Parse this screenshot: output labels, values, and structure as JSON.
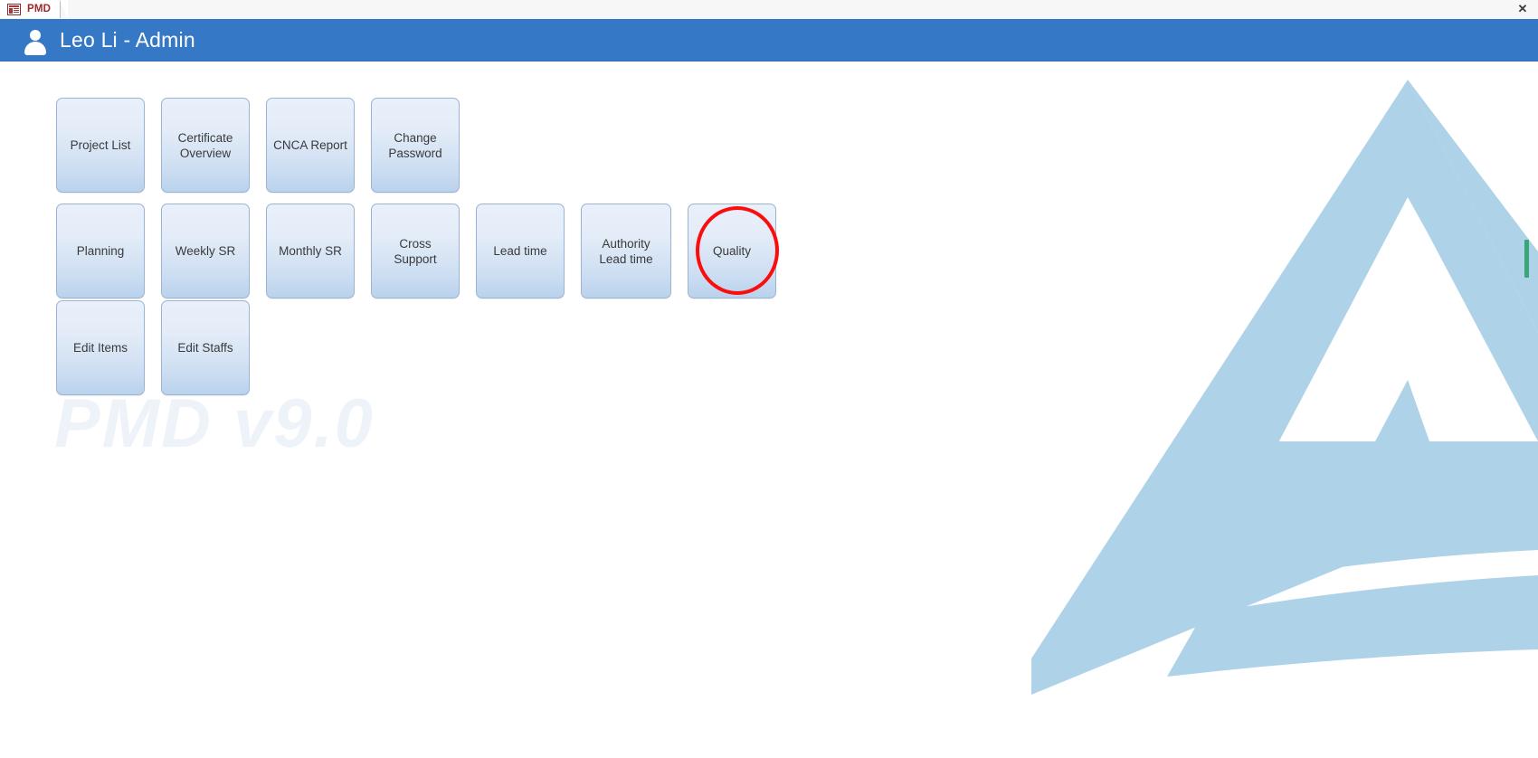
{
  "window": {
    "tab": {
      "label": "PMD",
      "icon": "form-table-icon"
    },
    "close_label": "✕"
  },
  "header": {
    "user_icon": "user-avatar-icon",
    "title": "Leo Li - Admin",
    "background_color": "#3478c6",
    "text_color": "#ffffff"
  },
  "watermark": {
    "text": "PMD v9.0",
    "color": "#eef3f9"
  },
  "logo": {
    "name": "company-triangle-logo",
    "color": "#aed2e8"
  },
  "annotation": {
    "shape": "circle",
    "color": "#fb0d0d",
    "targets": "Quality"
  },
  "scrollbar": {
    "thumb_color": "#3aa579"
  },
  "menu": {
    "rows": [
      {
        "buttons": [
          {
            "label": "Project List",
            "name": "project-list"
          },
          {
            "label": "Certificate Overview",
            "name": "certificate-overview"
          },
          {
            "label": "CNCA Report",
            "name": "cnca-report"
          },
          {
            "label": "Change Password",
            "name": "change-password"
          }
        ]
      },
      {
        "buttons": [
          {
            "label": "Planning",
            "name": "planning"
          },
          {
            "label": "Weekly SR",
            "name": "weekly-sr"
          },
          {
            "label": "Monthly SR",
            "name": "monthly-sr"
          },
          {
            "label": "Cross Support",
            "name": "cross-support"
          },
          {
            "label": "Lead time",
            "name": "lead-time"
          },
          {
            "label": "Authority Lead time",
            "name": "authority-lead-time"
          },
          {
            "label": "Quality",
            "name": "quality"
          }
        ]
      },
      {
        "buttons": [
          {
            "label": "Edit Items",
            "name": "edit-items"
          },
          {
            "label": "Edit Staffs",
            "name": "edit-staffs"
          }
        ]
      }
    ]
  }
}
